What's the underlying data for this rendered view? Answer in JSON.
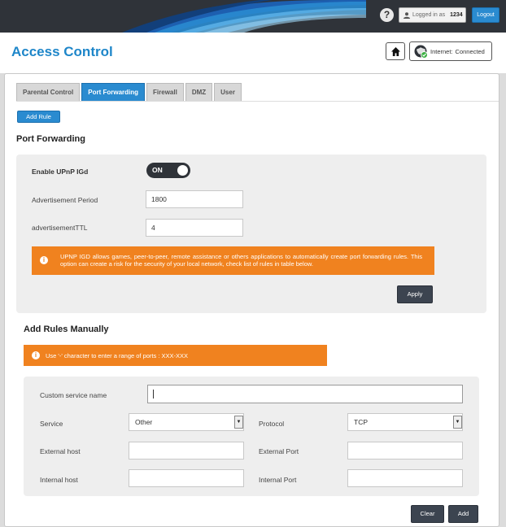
{
  "topbar": {
    "help_icon": "?",
    "logged_in_label": "Logged in as",
    "username": "1234",
    "logout_label": "Logout"
  },
  "header": {
    "title": "Access Control",
    "internet_label": "Internet:",
    "internet_status": "Connected"
  },
  "tabs": [
    {
      "label": "Parental Control",
      "active": false
    },
    {
      "label": "Port Forwarding",
      "active": true
    },
    {
      "label": "Firewall",
      "active": false
    },
    {
      "label": "DMZ",
      "active": false
    },
    {
      "label": "User",
      "active": false
    }
  ],
  "add_rule_label": "Add Rule",
  "port_forwarding": {
    "title": "Port Forwarding",
    "upnp_label": "Enable UPnP IGd",
    "upnp_state": "ON",
    "adv_period_label": "Advertisement Period",
    "adv_period_value": "1800",
    "adv_ttl_label": "advertisementTTL",
    "adv_ttl_value": "4",
    "warning_text": "UPNP IGD allows games, peer-to-peer, remote assistance or others applications to automatically create port forwarding rules. This option can create a risk for the security of your local network, check list of rules in table below.",
    "apply_label": "Apply"
  },
  "manual": {
    "title": "Add Rules Manually",
    "hint_text": "Use '-' character to enter a range of ports : XXX-XXX",
    "custom_service_label": "Custom service name",
    "custom_service_value": "",
    "service_label": "Service",
    "service_value": "Other",
    "protocol_label": "Protocol",
    "protocol_value": "TCP",
    "external_host_label": "External host",
    "external_host_value": "",
    "external_port_label": "External Port",
    "external_port_value": "",
    "internal_host_label": "Internal host",
    "internal_host_value": "",
    "internal_port_label": "Internal Port",
    "internal_port_value": "",
    "clear_label": "Clear",
    "add_label": "Add"
  },
  "colors": {
    "accent": "#2a8bd0",
    "warning": "#f0821f",
    "topbar": "#2f3339"
  }
}
